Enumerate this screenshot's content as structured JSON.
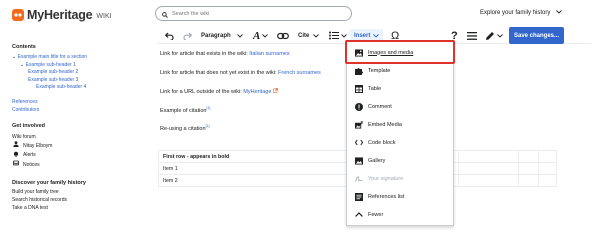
{
  "header": {
    "logo_text": "MyHeritage",
    "logo_suffix": "WIKI",
    "search_placeholder": "Search the wiki",
    "explore_label": "Explore your family history"
  },
  "toolbar": {
    "paragraph_label": "Paragraph",
    "cite_label": "Cite",
    "insert_label": "Insert",
    "save_label": "Save changes..."
  },
  "sidebar": {
    "contents_heading": "Contents",
    "toc": [
      "Example main title for a section",
      "Example sub-header 1",
      "Example sub-header 2",
      "Example sub-header 3",
      "Example sub-header 4"
    ],
    "references": "References",
    "contributors": "Contributors",
    "get_involved_heading": "Get involved",
    "wiki_forum": "Wiki forum",
    "user_name": "Nitay Elboym",
    "alerts": "Alerts",
    "notices": "Notices",
    "discover_heading": "Discover your family history",
    "build_tree": "Build your family tree",
    "search_records": "Search historical records",
    "dna_test": "Take a DNA test"
  },
  "content": {
    "line1_text": "Link for article that exists in the wiki: ",
    "line1_link": "Italian surnames",
    "line2_text": "Link for article that does not yet exist in the wiki: ",
    "line2_link": "French surnames",
    "line3_text": "Link for a URL outside of the wiki: ",
    "line3_link": "MyHeritage",
    "line4_text": "Example of citation",
    "line4_sup": "[1]",
    "line5_text": "Re-using a citation",
    "line5_sup": "[1]",
    "table": {
      "header": "First row - appears in bold",
      "rows": [
        "Item 1",
        "Item 2"
      ]
    }
  },
  "insert_menu": {
    "items": [
      "Images and media",
      "Template",
      "Table",
      "Comment",
      "Embed Media",
      "Code block",
      "Gallery",
      "Your signature",
      "References list",
      "Fewer"
    ]
  },
  "colors": {
    "link": "#3366cc",
    "highlight": "#e0322b",
    "primary_button": "#3366cc"
  }
}
